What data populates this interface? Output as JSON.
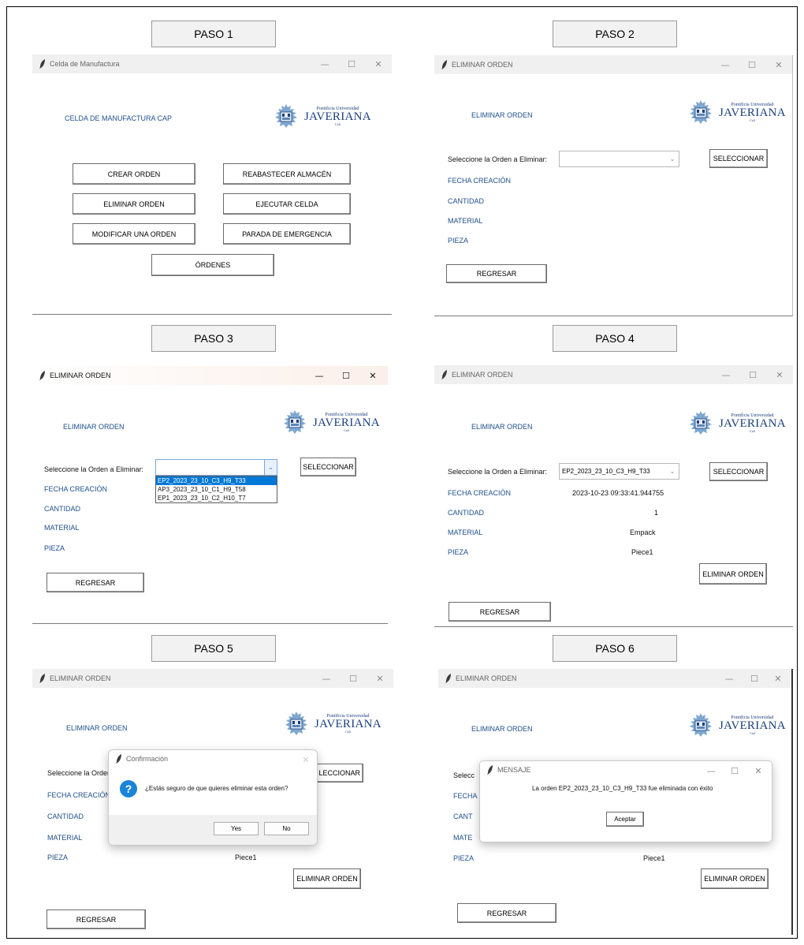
{
  "steps": [
    "PASO 1",
    "PASO 2",
    "PASO 3",
    "PASO 4",
    "PASO 5",
    "PASO 6"
  ],
  "logo": {
    "subtitle": "Pontificia Universidad",
    "name": "JAVERIANA",
    "city": "Cali"
  },
  "window_controls": {
    "minimize": "—",
    "maximize": "☐",
    "close": "✕"
  },
  "step1": {
    "window_title": "Celda de Manufactura",
    "heading": "CELDA DE MANUFACTURA CAP",
    "buttons": {
      "crear": "CREAR ORDEN",
      "reabastecer": "REABASTECER ALMACÉN",
      "eliminar": "ELIMINAR ORDEN",
      "ejecutar": "EJECUTAR CELDA",
      "modificar": "MODIFICAR UNA ORDEN",
      "parada": "PARADA DE EMERGENCIA",
      "ordenes": "ÓRDENES"
    }
  },
  "eliminar": {
    "window_title": "ELIMINAR ORDEN",
    "heading": "ELIMINAR ORDEN",
    "select_label": "Seleccione la Orden a Eliminar:",
    "select_button": "SELECCIONAR",
    "select_button_partial": "LECCIONAR",
    "select_label_partial": "Seleccione la Orden",
    "select_label_short": "Selecc",
    "fecha_label": "FECHA CREACIÓN",
    "fecha_short": "FECHA",
    "cantidad_label": "CANTIDAD",
    "cantidad_short": "CANT",
    "material_label": "MATERIAL",
    "material_short": "MATE",
    "pieza_label": "PIEZA",
    "regresar": "REGRESAR",
    "eliminar_button": "ELIMINAR ORDEN"
  },
  "step3": {
    "options": [
      "EP2_2023_23_10_C3_H9_T33",
      "AP3_2023_23_10_C1_H9_T58",
      "EP1_2023_23_10_C2_H10_T7"
    ]
  },
  "step4": {
    "selected_order": "EP2_2023_23_10_C3_H9_T33",
    "fecha": "2023-10-23 09:33:41.944755",
    "cantidad": "1",
    "material": "Empack",
    "pieza": "Piece1"
  },
  "step5": {
    "dialog_title": "Confirmación",
    "question": "¿Estás seguro de que quieres eliminar esta orden?",
    "yes": "Yes",
    "no": "No",
    "pieza": "Piece1"
  },
  "step6": {
    "dialog_title": "MENSAJE",
    "message": "La orden EP2_2023_23_10_C3_H9_T33 fue eliminada con éxito",
    "accept": "Aceptar",
    "pieza": "Piece1"
  }
}
